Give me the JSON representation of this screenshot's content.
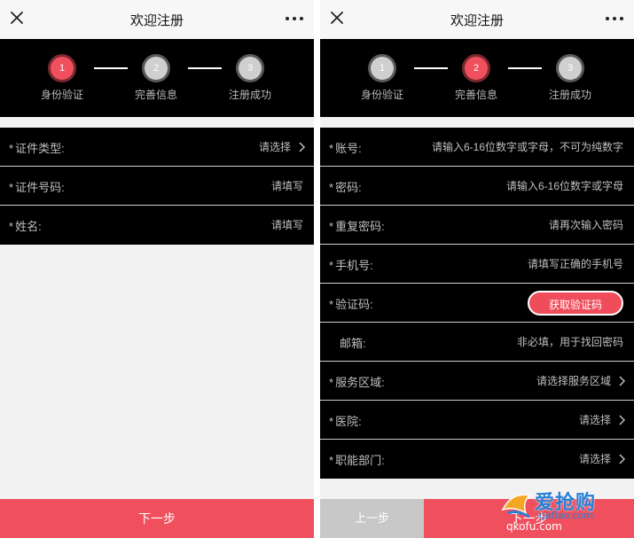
{
  "left": {
    "nav": {
      "title": "欢迎注册"
    },
    "steps": [
      {
        "number": "1",
        "label": "身份验证",
        "active": true
      },
      {
        "number": "2",
        "label": "完善信息",
        "active": false
      },
      {
        "number": "3",
        "label": "注册成功",
        "active": false
      }
    ],
    "form": [
      {
        "required": "*",
        "label": "证件类型:",
        "value": "请选择",
        "chevron": true
      },
      {
        "required": "*",
        "label": "证件号码:",
        "value": "请填写",
        "chevron": false
      },
      {
        "required": "*",
        "label": "姓名:",
        "value": "请填写",
        "chevron": false
      }
    ],
    "next_label": "下一步"
  },
  "right": {
    "nav": {
      "title": "欢迎注册"
    },
    "steps": [
      {
        "number": "1",
        "label": "身份验证",
        "active": false
      },
      {
        "number": "2",
        "label": "完善信息",
        "active": true
      },
      {
        "number": "3",
        "label": "注册成功",
        "active": false
      }
    ],
    "form": [
      {
        "required": "*",
        "label": "账号:",
        "value": "请输入6-16位数字或字母，不可为纯数字",
        "chevron": false
      },
      {
        "required": "*",
        "label": "密码:",
        "value": "请输入6-16位数字或字母",
        "chevron": false
      },
      {
        "required": "*",
        "label": "重复密码:",
        "value": "请再次输入密码",
        "chevron": false
      },
      {
        "required": "*",
        "label": "手机号:",
        "value": "请填写正确的手机号",
        "chevron": false
      },
      {
        "required": "*",
        "label": "验证码:",
        "value": "",
        "chevron": false,
        "button": "获取验证码"
      },
      {
        "required": "",
        "label": "邮箱:",
        "value": "非必填，用于找回密码",
        "chevron": false
      },
      {
        "required": "*",
        "label": "服务区域:",
        "value": "请选择服务区域",
        "chevron": true
      },
      {
        "required": "*",
        "label": "医院:",
        "value": "请选择",
        "chevron": true
      },
      {
        "required": "*",
        "label": "职能部门:",
        "value": "请选择",
        "chevron": true
      }
    ],
    "prev_label": "上一步",
    "next_label": "下一步"
  },
  "watermark": {
    "line1": "爱抢购",
    "line2": "igaflao.com",
    "line3": "qkofu.com"
  },
  "colors": {
    "accent": "#f0505d",
    "panel": "#000000",
    "background": "#f2f2f2",
    "prev_button": "#c8c8c8"
  },
  "icons": {
    "close": "close-icon",
    "more": "more-dots-icon",
    "chevron": "chevron-right-icon"
  }
}
